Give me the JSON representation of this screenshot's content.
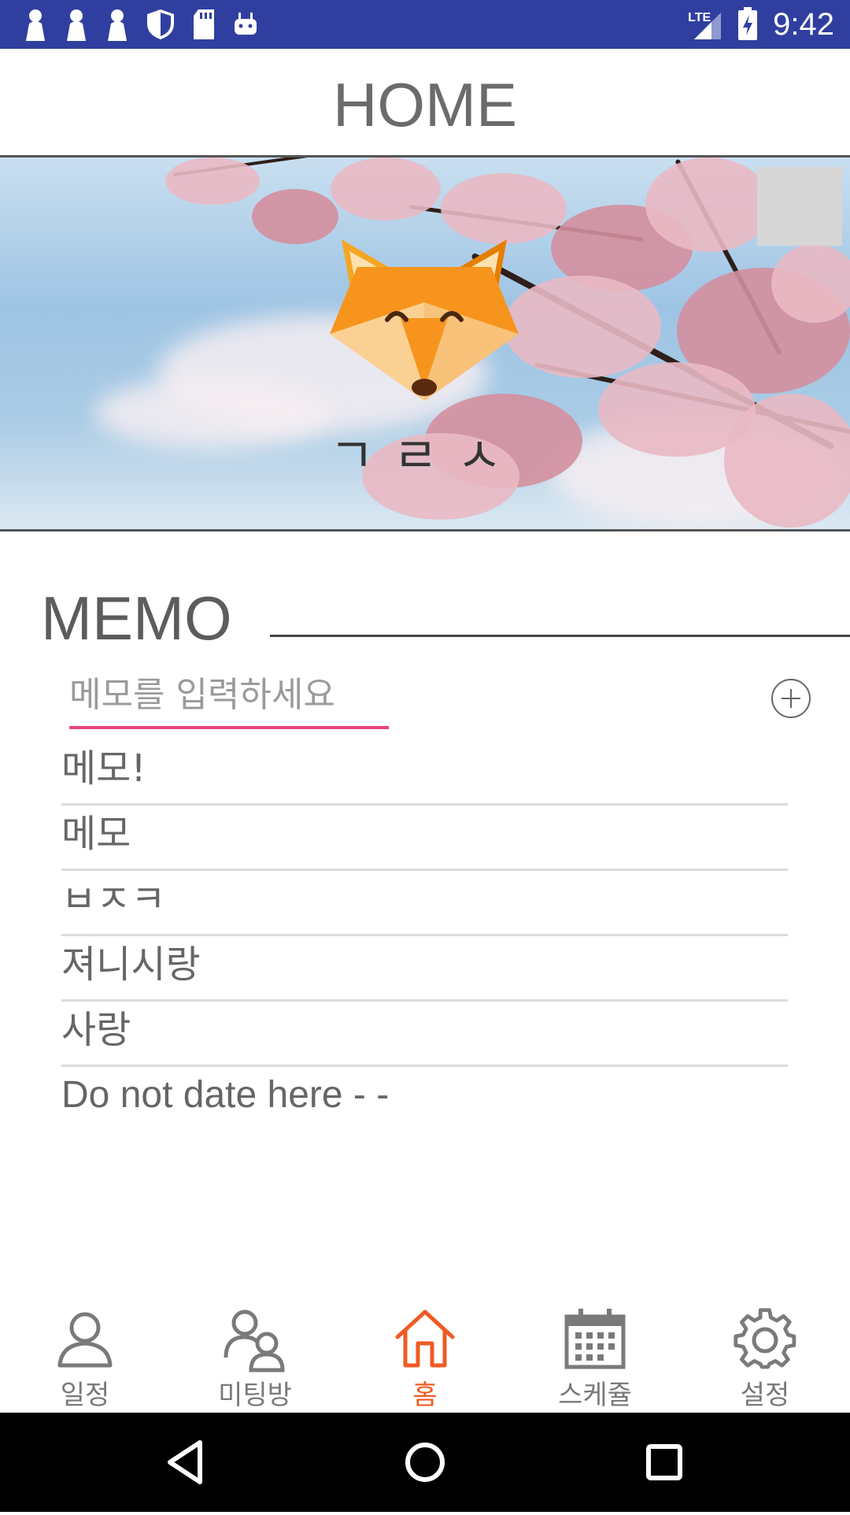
{
  "status_bar": {
    "time": "9:42",
    "network": "LTE",
    "left_icons": [
      "person-icon",
      "person-icon",
      "person-icon",
      "shield-icon",
      "sd-card-icon",
      "android-icon"
    ],
    "right_icons": [
      "signal-icon",
      "battery-charging-icon"
    ]
  },
  "header": {
    "title": "HOME"
  },
  "banner": {
    "profile_name": "ㄱㄹㅅ",
    "avatar_icon": "fox-icon"
  },
  "memo": {
    "title": "MEMO",
    "input_placeholder": "메모를 입력하세요",
    "add_icon": "plus-circle-icon",
    "items": [
      "메모!",
      "메모",
      "ㅂㅈㅋ",
      "져니시랑",
      "사랑",
      "Do not date here - -"
    ]
  },
  "bottom_nav": {
    "items": [
      {
        "label": "일정",
        "icon": "person-icon"
      },
      {
        "label": "미팅방",
        "icon": "people-icon"
      },
      {
        "label": "홈",
        "icon": "home-icon"
      },
      {
        "label": "스케쥴",
        "icon": "calendar-icon"
      },
      {
        "label": "설정",
        "icon": "gear-icon"
      }
    ],
    "active_index": 2,
    "active_color": "#f05a23"
  },
  "system_nav": {
    "buttons": [
      "back-icon",
      "home-circle-icon",
      "recents-icon"
    ]
  }
}
